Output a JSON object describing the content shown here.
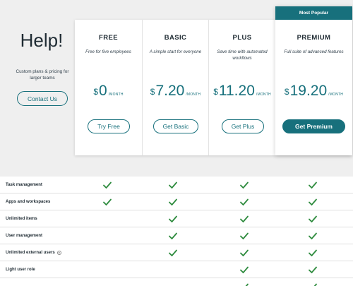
{
  "help": {
    "title": "Help!",
    "subtitle": "Custom plans & pricing for larger teams",
    "contact_label": "Contact Us"
  },
  "badge": {
    "label": "Most Popular"
  },
  "plans": [
    {
      "name": "FREE",
      "description": "Free for five employees",
      "currency": "$",
      "amount": "0",
      "period": "/MONTH",
      "cta": "Try Free"
    },
    {
      "name": "BASIC",
      "description": "A simple start for everyone",
      "currency": "$",
      "amount": "7.20",
      "period": "/MONTH",
      "cta": "Get Basic"
    },
    {
      "name": "PLUS",
      "description": "Save time with automated workflows",
      "currency": "$",
      "amount": "11.20",
      "period": "/MONTH",
      "cta": "Get Plus"
    },
    {
      "name": "PREMIUM",
      "description": "Full suite of advanced features",
      "currency": "$",
      "amount": "19.20",
      "period": "/MONTH",
      "cta": "Get Premium"
    }
  ],
  "features": [
    {
      "label": "Task management",
      "checks": [
        true,
        true,
        true,
        true
      ]
    },
    {
      "label": "Apps and workspaces",
      "checks": [
        true,
        true,
        true,
        true
      ]
    },
    {
      "label": "Unlimited items",
      "checks": [
        false,
        true,
        true,
        true
      ]
    },
    {
      "label": "User management",
      "checks": [
        false,
        true,
        true,
        true
      ]
    },
    {
      "label": "Unlimited external users",
      "help_icon": "?",
      "checks": [
        false,
        true,
        true,
        true
      ]
    },
    {
      "label": "Light user role",
      "checks": [
        false,
        false,
        true,
        true
      ]
    },
    {
      "label": "",
      "checks": [
        false,
        false,
        true,
        true
      ]
    }
  ],
  "colors": {
    "accent": "#17707c",
    "check": "#2e8b3e",
    "background": "#efefef"
  }
}
